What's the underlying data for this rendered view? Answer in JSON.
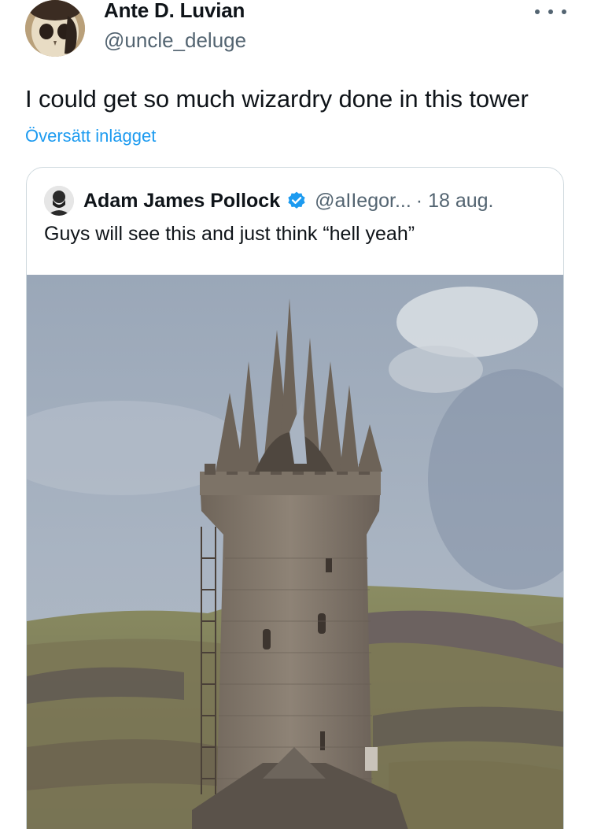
{
  "tweet": {
    "author": {
      "display_name": "Ante D. Luvian",
      "handle": "@uncle_deluge",
      "avatar_icon": "skull-mask-avatar-icon"
    },
    "more_icon": "more-dots-icon",
    "text": "I could get so much wizardry done in this tower",
    "translate_label": "Översätt inlägget"
  },
  "quote": {
    "author": {
      "display_name": "Adam James Pollock",
      "handle": "@aIIegor...",
      "avatar_icon": "bearded-man-avatar-icon",
      "verified_icon": "verified-badge-icon"
    },
    "date": "· 18 aug.",
    "text": "Guys will see this and just think “hell yeah”",
    "media_description": ""
  },
  "colors": {
    "text_primary": "#0f1419",
    "text_secondary": "#536471",
    "link": "#1d9bf0",
    "border": "#cfd9de"
  }
}
